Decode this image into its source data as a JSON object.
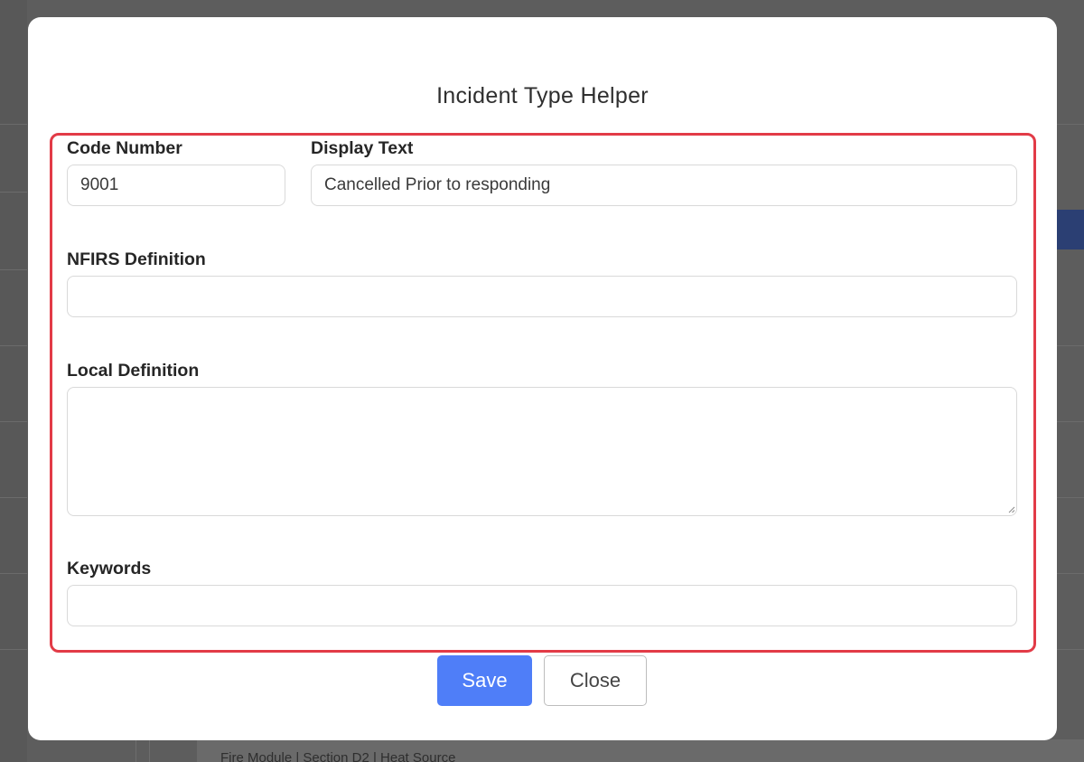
{
  "modal": {
    "title": "Incident Type Helper",
    "fields": {
      "code_number": {
        "label": "Code Number",
        "value": "9001",
        "placeholder": ""
      },
      "display_text": {
        "label": "Display Text",
        "value": "Cancelled Prior to responding",
        "placeholder": ""
      },
      "nfirs_definition": {
        "label": "NFIRS Definition",
        "value": "",
        "placeholder": ""
      },
      "local_definition": {
        "label": "Local Definition",
        "value": "",
        "placeholder": ""
      },
      "keywords": {
        "label": "Keywords",
        "value": "",
        "placeholder": ""
      }
    },
    "buttons": {
      "save_label": "Save",
      "close_label": "Close"
    }
  },
  "background": {
    "footer_text": "Fire Module | Section D2 | Heat Source"
  },
  "colors": {
    "accent": "#4f7ef8",
    "highlight": "#e23b47",
    "overlay": "#5d5d5d"
  }
}
